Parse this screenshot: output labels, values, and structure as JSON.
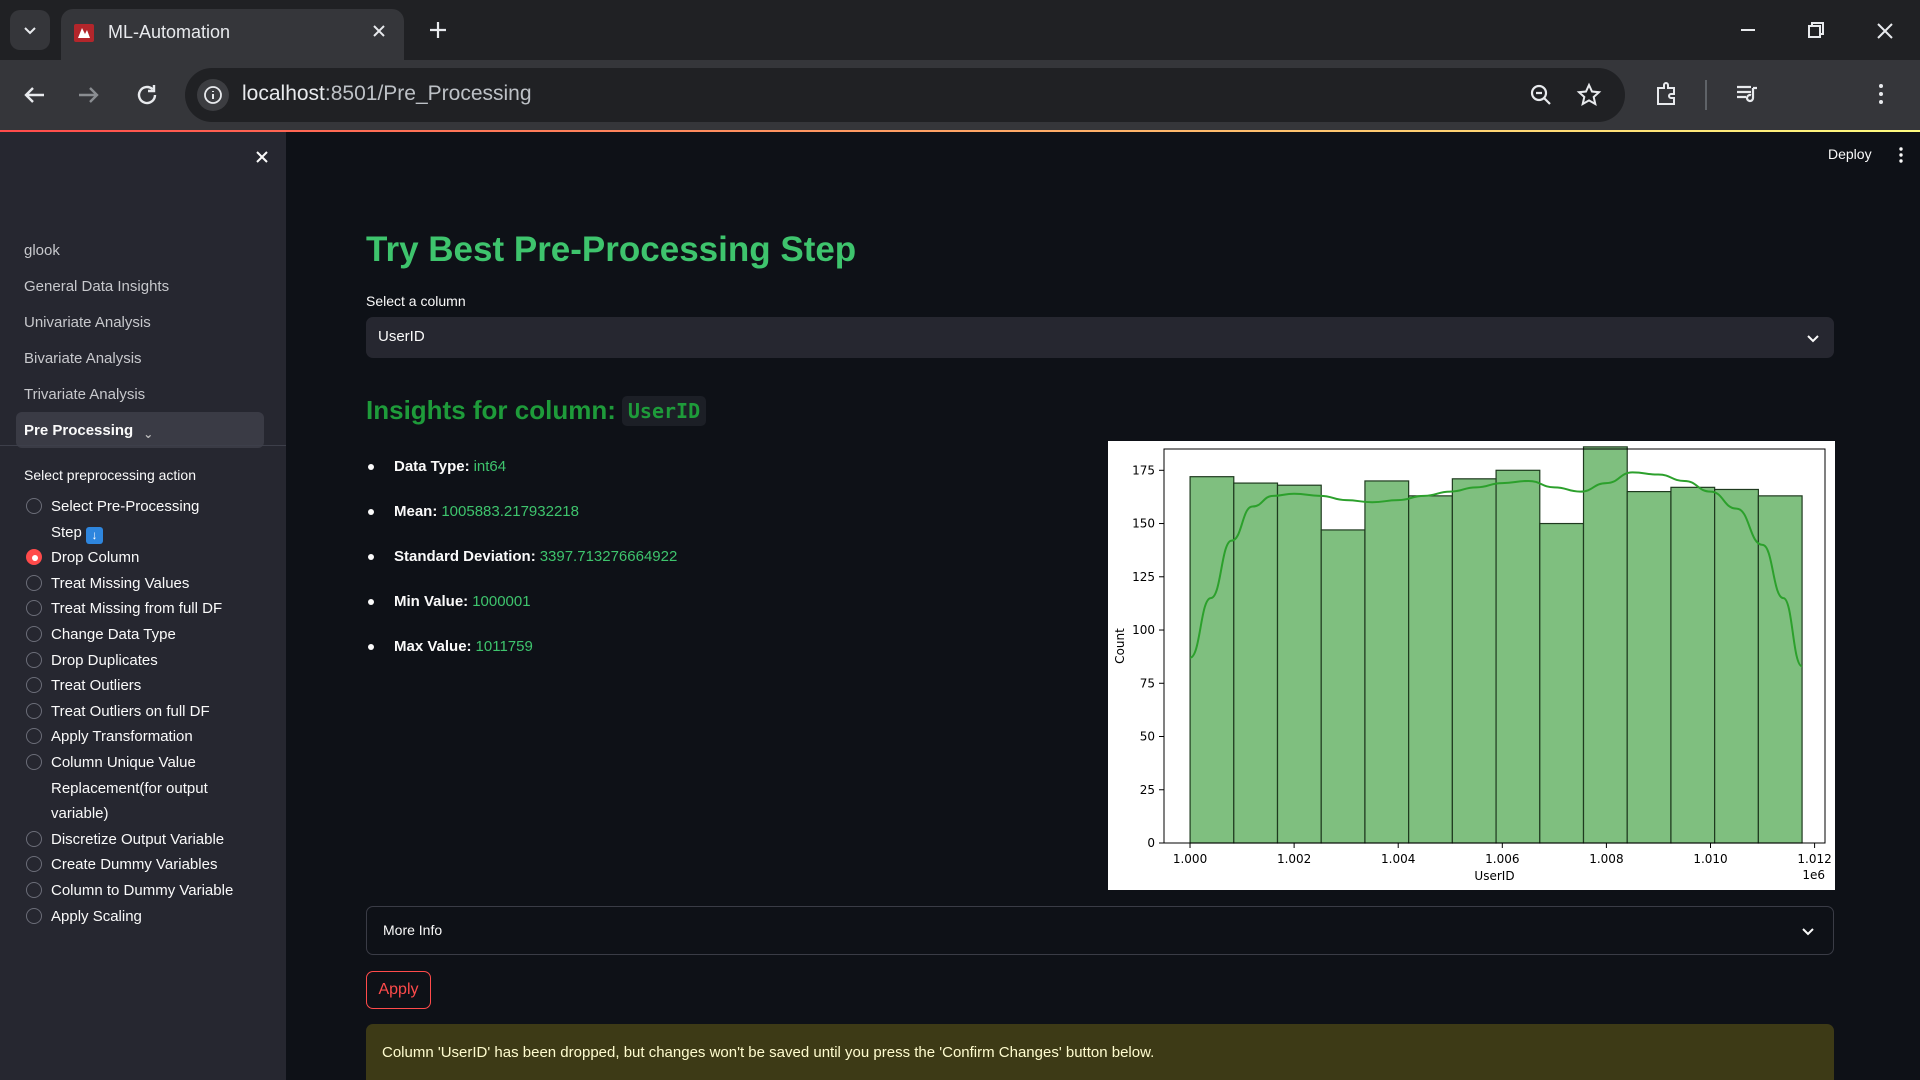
{
  "browser": {
    "tab_title": "ML-Automation",
    "url_host": "localhost",
    "url_path": ":8501/Pre_Processing"
  },
  "app": {
    "deploy_label": "Deploy"
  },
  "sidebar": {
    "nav_items": [
      {
        "label": "glook"
      },
      {
        "label": "General Data Insights"
      },
      {
        "label": "Univariate Analysis"
      },
      {
        "label": "Bivariate Analysis"
      },
      {
        "label": "Trivariate Analysis"
      },
      {
        "label": "Pre Processing"
      }
    ],
    "radio_label": "Select preprocessing action",
    "radio_options": [
      {
        "label": "Select Pre-Processing Step",
        "checked": false
      },
      {
        "label": "Drop Column",
        "checked": true
      },
      {
        "label": "Treat Missing Values",
        "checked": false
      },
      {
        "label": "Treat Missing from full DF",
        "checked": false
      },
      {
        "label": "Change Data Type",
        "checked": false
      },
      {
        "label": "Drop Duplicates",
        "checked": false
      },
      {
        "label": "Treat Outliers",
        "checked": false
      },
      {
        "label": "Treat Outliers on full DF",
        "checked": false
      },
      {
        "label": "Apply Transformation",
        "checked": false
      },
      {
        "label": "Column Unique Value Replacement(for output variable)",
        "checked": false
      },
      {
        "label": "Discretize Output Variable",
        "checked": false
      },
      {
        "label": "Create Dummy Variables",
        "checked": false
      },
      {
        "label": "Column to Dummy Variable",
        "checked": false
      },
      {
        "label": "Apply Scaling",
        "checked": false
      }
    ]
  },
  "main": {
    "title": "Try Best Pre-Processing Step",
    "select_label": "Select a column",
    "select_value": "UserID",
    "insights_prefix": "Insights for column:",
    "insights_column": "UserID",
    "stats": [
      {
        "key": "Data Type:",
        "value": "int64"
      },
      {
        "key": "Mean:",
        "value": "1005883.217932218"
      },
      {
        "key": "Standard Deviation:",
        "value": "3397.713276664922"
      },
      {
        "key": "Min Value:",
        "value": "1000001"
      },
      {
        "key": "Max Value:",
        "value": "1011759"
      }
    ],
    "expander_label": "More Info",
    "apply_label": "Apply",
    "warning": "Column 'UserID' has been dropped, but changes won't be saved until you press the 'Confirm Changes' button below."
  },
  "chart_data": {
    "type": "bar",
    "subtype": "histogram_with_kde",
    "xlabel": "UserID",
    "ylabel": "Count",
    "x_offset_label": "1e6",
    "xlim": [
      0.9995,
      1.0122
    ],
    "ylim": [
      0,
      185
    ],
    "x_ticks": [
      1.0,
      1.002,
      1.004,
      1.006,
      1.008,
      1.01,
      1.012
    ],
    "x_tick_labels": [
      "1.000",
      "1.002",
      "1.004",
      "1.006",
      "1.008",
      "1.010",
      "1.012"
    ],
    "y_ticks": [
      0,
      25,
      50,
      75,
      100,
      125,
      150,
      175
    ],
    "bin_edges": [
      1.000001,
      1.0008409,
      1.0016808,
      1.0025207,
      1.0033606,
      1.0042005,
      1.0050404,
      1.0058803,
      1.0067202,
      1.0075601,
      1.0084,
      1.0092399,
      1.0100798,
      1.0109197,
      1.0117596
    ],
    "values": [
      172,
      169,
      168,
      147,
      170,
      163,
      171,
      175,
      150,
      186,
      165,
      167,
      166,
      163
    ],
    "kde_x": [
      1.000001,
      1.0004,
      1.0008,
      1.0012,
      1.0016,
      1.002,
      1.0025,
      1.003,
      1.0035,
      1.004,
      1.0045,
      1.005,
      1.0055,
      1.006,
      1.0065,
      1.007,
      1.0075,
      1.008,
      1.0085,
      1.009,
      1.0095,
      1.01,
      1.0105,
      1.011,
      1.0114,
      1.0117596
    ],
    "kde_y": [
      87,
      115,
      142,
      158,
      163,
      164,
      163,
      161,
      160,
      161,
      163,
      165,
      167,
      169,
      170,
      167,
      165,
      169,
      174,
      173,
      170,
      165,
      157,
      140,
      115,
      83
    ],
    "bar_color": "#7fbf7f",
    "bar_edge": "#1f3a1f",
    "kde_color": "#2ca02c",
    "grid": false
  },
  "colors": {
    "accent": "#ff4b4b",
    "title_green": "#3ec46d",
    "insights_green": "#1e9b3a",
    "warning_bg": "#3d3a16"
  }
}
